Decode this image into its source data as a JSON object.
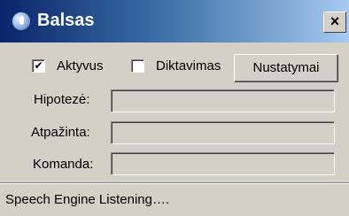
{
  "window": {
    "title": "Balsas",
    "close_glyph": "×"
  },
  "options": {
    "active": {
      "label": "Aktyvus",
      "checked": true,
      "mark": "✔"
    },
    "dictation": {
      "label": "Diktavimas",
      "checked": false,
      "mark": ""
    },
    "settings_button": "Nustatymai"
  },
  "fields": {
    "hypothesis": {
      "label": "Hipotezė:",
      "value": ""
    },
    "recognized": {
      "label": "Atpažinta:",
      "value": ""
    },
    "command": {
      "label": "Komanda:",
      "value": ""
    }
  },
  "status": {
    "text": "Speech Engine Listening…."
  },
  "colors": {
    "title_bar": "#0a246a",
    "face": "#d4d0c8"
  }
}
